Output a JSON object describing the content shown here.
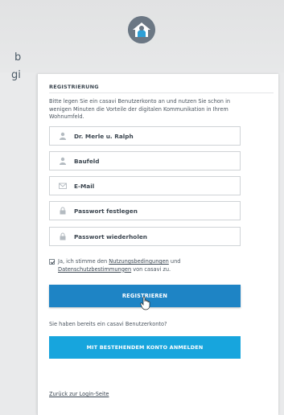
{
  "background": {
    "text_line_1": "b",
    "text_line_2": "gi"
  },
  "form": {
    "title": "REGISTRIERUNG",
    "intro": "Bitte legen Sie ein casavi Benutzerkonto an und nutzen Sie schon in wenigen Minuten die Vorteile der digitalen Kommunikation in Ihrem Wohnumfeld.",
    "fields": [
      {
        "label": "Dr. Merle u. Ralph",
        "icon": "user-icon"
      },
      {
        "label": "Baufeld",
        "icon": "user-icon"
      },
      {
        "label": "E-Mail",
        "icon": "envelope-icon"
      },
      {
        "label": "Passwort festlegen",
        "icon": "lock-icon"
      },
      {
        "label": "Passwort wiederholen",
        "icon": "lock-icon"
      }
    ],
    "terms": {
      "checked": true,
      "prefix": "Ja, ich stimme den ",
      "link1": "Nutzungsbedingungen",
      "middle": " und ",
      "link2": "Datenschutzbestimmungen",
      "suffix": " von casavi zu."
    },
    "register_button": "REGISTRIEREN",
    "have_account_text": "Sie haben bereits ein casavi Benutzerkonto?",
    "login_button": "MIT BESTEHENDEM KONTO ANMELDEN",
    "back_link": "Zurück zur Login-Seite"
  },
  "colors": {
    "register_button": "#1e84c5",
    "login_button": "#17a5dd",
    "logo": "#6d7a86"
  }
}
